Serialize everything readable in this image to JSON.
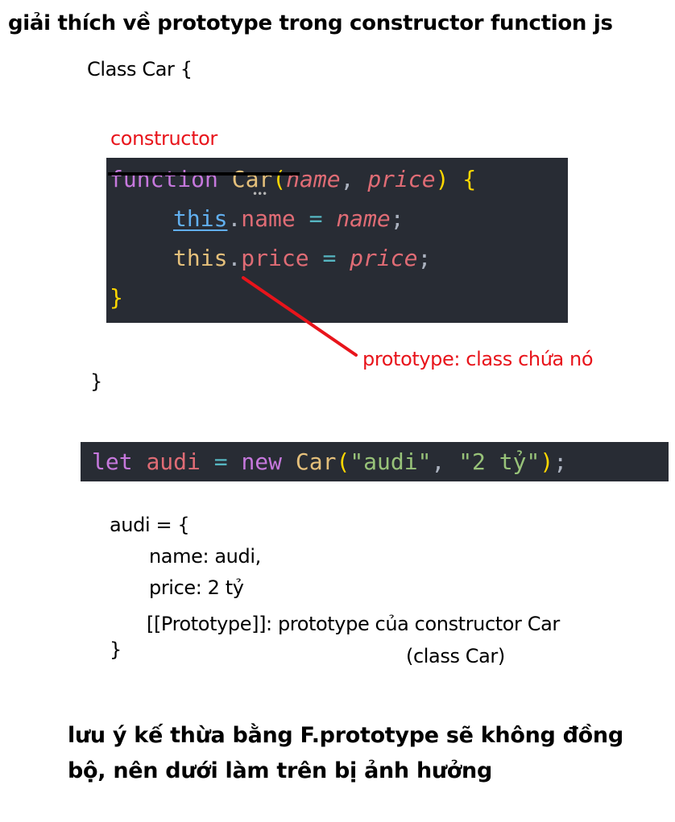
{
  "title": "giải thích về prototype trong constructor function js",
  "class_open": "Class Car {",
  "constructor_label": "constructor",
  "code1": {
    "line1": {
      "kw": "function",
      "name": "Car",
      "open_paren": "(",
      "p1": "name",
      "comma": ", ",
      "p2": "price",
      "close_paren": ")",
      "brace": "{"
    },
    "line2": {
      "this": "this",
      "dot": ".",
      "prop": "name",
      "eq": "=",
      "val": "name",
      "semi": ";"
    },
    "line3": {
      "this": "this",
      "dot": ".",
      "prop": "price",
      "eq": "=",
      "val": "price",
      "semi": ";"
    },
    "line4": {
      "brace": "}"
    }
  },
  "arrow_label": "prototype: class chứa nó",
  "class_close": "}",
  "code2": {
    "kw_let": "let",
    "var": "audi",
    "eq": "=",
    "kw_new": "new",
    "ctor": "Car",
    "open_paren": "(",
    "arg1": "\"audi\"",
    "comma": ", ",
    "arg2": "\"2 tỷ\"",
    "close_paren": ")",
    "semi": ";"
  },
  "object": {
    "open": "audi = {",
    "name_line": "name: audi,",
    "price_line": "price: 2 tỷ",
    "proto_line": "[[Prototype]]: prototype của constructor Car",
    "proto_note": "(class Car)",
    "close": "}"
  },
  "final_note": "lưu ý kế thừa bằng F.prototype sẽ không đồng bộ, nên dưới làm trên bị ảnh hưởng",
  "colors": {
    "code_bg": "#282c34",
    "annotation_red": "#e8141b",
    "arrow_red": "#e8141b"
  }
}
